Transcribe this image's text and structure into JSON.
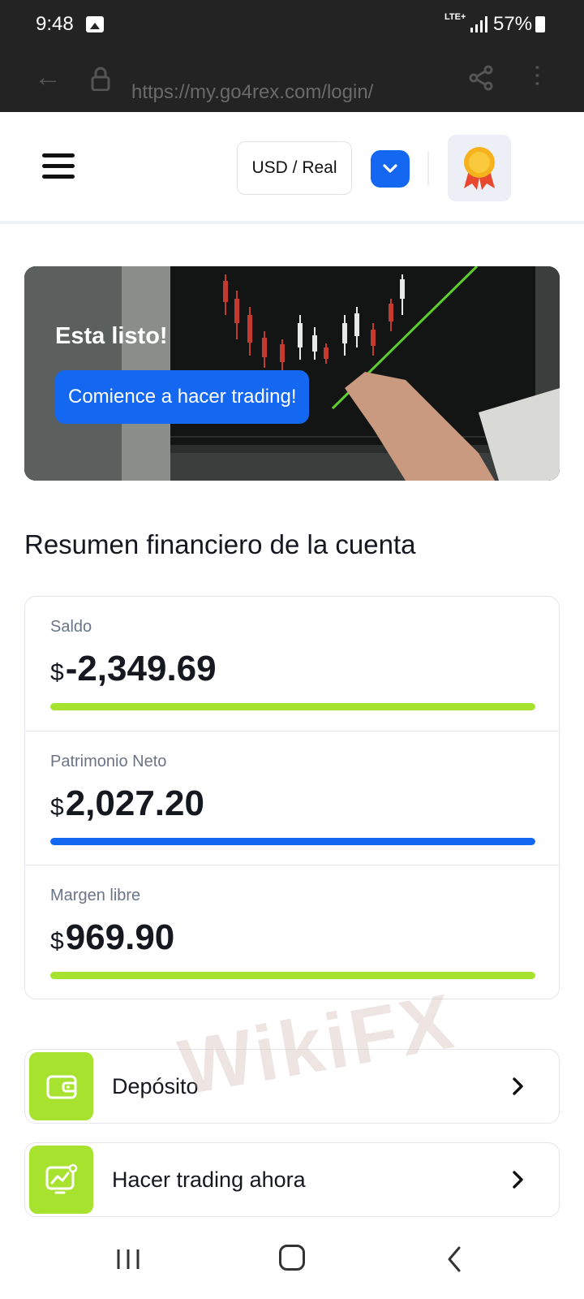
{
  "status_bar": {
    "time": "9:48",
    "network": "LTE+",
    "battery": "57%"
  },
  "browser": {
    "url": "https://my.go4rex.com/login/"
  },
  "header": {
    "account_selector": "USD / Real"
  },
  "banner": {
    "title": "Esta listo!",
    "cta_label": "Comience a hacer trading!"
  },
  "summary": {
    "title": "Resumen financiero de la cuenta",
    "currency_symbol": "$",
    "metrics": [
      {
        "label": "Saldo",
        "value": "-2,349.69",
        "bar_color": "#a6e22e",
        "bar_fill": 1.0
      },
      {
        "label": "Patrimonio Neto",
        "value": "2,027.20",
        "bar_color": "#1467f0",
        "bar_fill": 1.0
      },
      {
        "label": "Margen libre",
        "value": "969.90",
        "bar_color": "#a6e22e",
        "bar_fill": 1.0
      }
    ]
  },
  "actions": [
    {
      "label": "Depósito",
      "icon": "wallet-icon"
    },
    {
      "label": "Hacer trading ahora",
      "icon": "trading-chart-icon"
    }
  ],
  "watermark": "WikiFX",
  "colors": {
    "accent_blue": "#1467f0",
    "accent_green": "#a6e22e",
    "text_dark": "#16181f",
    "label_gray": "#6b7487"
  }
}
